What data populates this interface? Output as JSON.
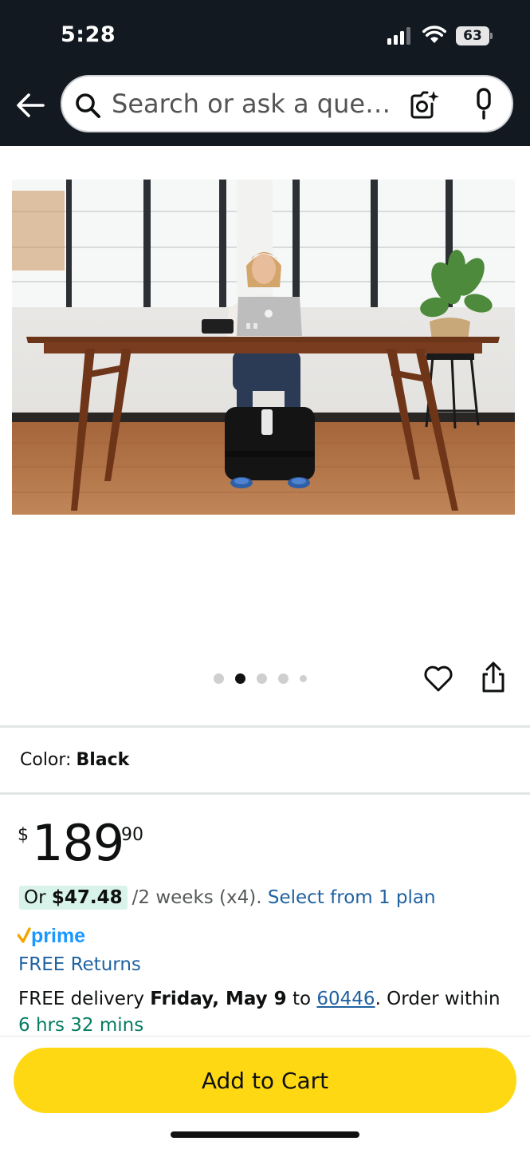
{
  "status_bar": {
    "time": "5:28",
    "battery": "63"
  },
  "header": {
    "search_placeholder": "Search or ask a que…"
  },
  "gallery": {
    "total_images": 5,
    "active_index": 1
  },
  "color": {
    "label": "Color:",
    "value": "Black"
  },
  "price": {
    "symbol": "$",
    "whole": "189",
    "fraction": "90"
  },
  "installment": {
    "prefix": "Or ",
    "amount": "$47.48",
    "period": "/2 weeks (x4).",
    "link": "Select from 1 plan"
  },
  "prime": {
    "label": "prime"
  },
  "returns": {
    "label": "FREE Returns"
  },
  "delivery": {
    "prefix": "FREE delivery ",
    "date": "Friday, May 9",
    "to": " to ",
    "zip": "60446",
    "order_within": ". Order within ",
    "time_left": "6 hrs 32 mins"
  },
  "cta": {
    "add_to_cart": "Add to Cart"
  },
  "colors": {
    "header_bg": "#131921",
    "prime_blue": "#1a98ff",
    "prime_check": "#f0a500",
    "link": "#2162a1",
    "green": "#067d62",
    "cart_yellow": "#ffd814"
  }
}
